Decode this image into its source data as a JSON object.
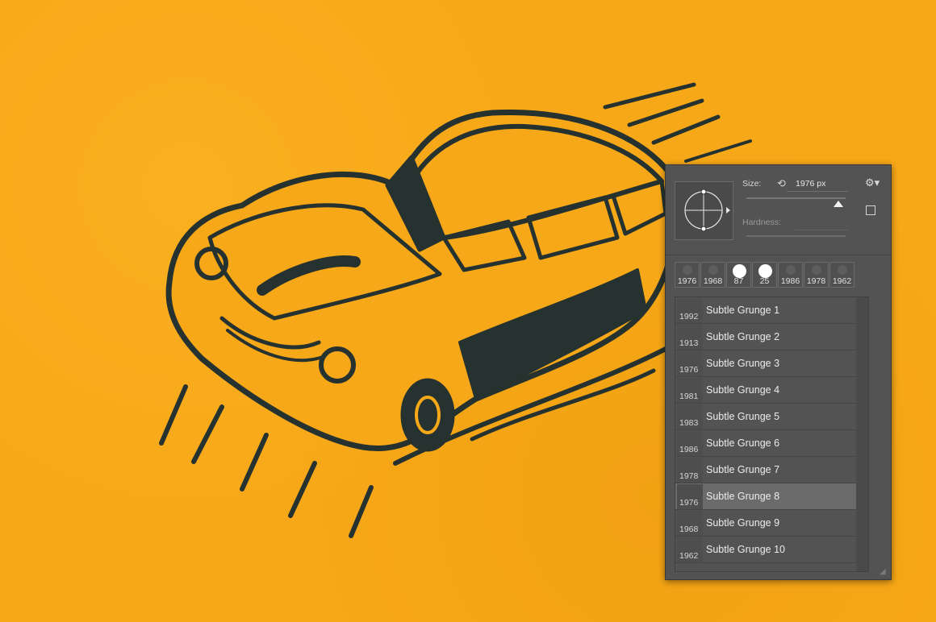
{
  "colors": {
    "background": "#f7a818",
    "ink": "#26322f",
    "panel": "#535353",
    "selected": "#6b6b6b"
  },
  "brush_panel": {
    "size_label": "Size:",
    "size_value": "1976 px",
    "size_slider_fraction": 0.93,
    "hardness_label": "Hardness:",
    "recent_brushes": [
      "1976",
      "1968",
      "87",
      "25",
      "1986",
      "1978",
      "1962"
    ],
    "presets": [
      {
        "num": "1992",
        "name": "Subtle Grunge 1"
      },
      {
        "num": "1913",
        "name": "Subtle Grunge 2"
      },
      {
        "num": "1976",
        "name": "Subtle Grunge 3"
      },
      {
        "num": "1981",
        "name": "Subtle Grunge 4"
      },
      {
        "num": "1983",
        "name": "Subtle Grunge 5"
      },
      {
        "num": "1986",
        "name": "Subtle Grunge 6"
      },
      {
        "num": "1978",
        "name": "Subtle Grunge 7"
      },
      {
        "num": "1976",
        "name": "Subtle Grunge 8"
      },
      {
        "num": "1968",
        "name": "Subtle Grunge 9"
      },
      {
        "num": "1962",
        "name": "Subtle Grunge 10"
      }
    ],
    "selected_index": 7
  }
}
